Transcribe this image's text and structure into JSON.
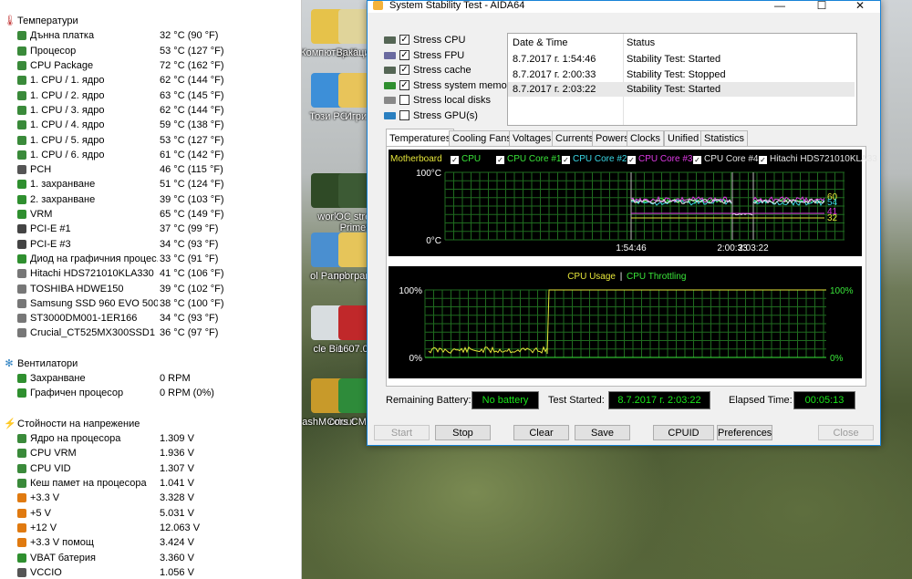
{
  "desktop": {
    "icons": [
      {
        "label": "Компютър К",
        "color": "#e6c24a"
      },
      {
        "label": "Вакация",
        "color": "#e0d49a"
      },
      {
        "label": "Този PC",
        "color": "#3d8fd8"
      },
      {
        "label": "Игри",
        "color": "#e8c45a"
      },
      {
        "label": "work",
        "color": "#2f4a26"
      },
      {
        "label": "OC stres Prime9",
        "color": "#3c5a34"
      },
      {
        "label": "ol Panel",
        "color": "#4a8fd0"
      },
      {
        "label": "програми",
        "color": "#e6c55a"
      },
      {
        "label": "cle Bin",
        "color": "#d8dde0"
      },
      {
        "label": "1607.04",
        "color": "#c0282a"
      },
      {
        "label": "ashM ortcut",
        "color": "#c89a2a"
      },
      {
        "label": "Cors CMK32",
        "color": "#2e8b3a"
      }
    ]
  },
  "sensors": {
    "groups": [
      {
        "title": "Температури",
        "icon": "thermometer-icon",
        "icon_color": "#c03030",
        "rows": [
          {
            "name": "Дънна платка",
            "value": "32 °C  (90 °F)",
            "icon": "motherboard-icon",
            "color": "#3a8a3a"
          },
          {
            "name": "Процесор",
            "value": "53 °C  (127 °F)",
            "icon": "cpu-icon",
            "color": "#3a8a3a"
          },
          {
            "name": "CPU Package",
            "value": "72 °C  (162 °F)",
            "icon": "cpu-icon",
            "color": "#3a8a3a"
          },
          {
            "name": "1. CPU / 1. ядро",
            "value": "62 °C  (144 °F)",
            "icon": "cpu-icon",
            "color": "#3a8a3a"
          },
          {
            "name": "1. CPU / 2. ядро",
            "value": "63 °C  (145 °F)",
            "icon": "cpu-icon",
            "color": "#3a8a3a"
          },
          {
            "name": "1. CPU / 3. ядро",
            "value": "62 °C  (144 °F)",
            "icon": "cpu-icon",
            "color": "#3a8a3a"
          },
          {
            "name": "1. CPU / 4. ядро",
            "value": "59 °C  (138 °F)",
            "icon": "cpu-icon",
            "color": "#3a8a3a"
          },
          {
            "name": "1. CPU / 5. ядро",
            "value": "53 °C  (127 °F)",
            "icon": "cpu-icon",
            "color": "#3a8a3a"
          },
          {
            "name": "1. CPU / 6. ядро",
            "value": "61 °C  (142 °F)",
            "icon": "cpu-icon",
            "color": "#3a8a3a"
          },
          {
            "name": "PCH",
            "value": "46 °C  (115 °F)",
            "icon": "chip-icon",
            "color": "#555555"
          },
          {
            "name": "1. захранване",
            "value": "51 °C  (124 °F)",
            "icon": "power-icon",
            "color": "#2f8f2f"
          },
          {
            "name": "2. захранване",
            "value": "39 °C  (103 °F)",
            "icon": "power-icon",
            "color": "#2f8f2f"
          },
          {
            "name": "VRM",
            "value": "65 °C  (149 °F)",
            "icon": "power-icon",
            "color": "#2f8f2f"
          },
          {
            "name": "PCI-E #1",
            "value": "37 °C  (99 °F)",
            "icon": "slot-icon",
            "color": "#444444"
          },
          {
            "name": "PCI-E #3",
            "value": "34 °C  (93 °F)",
            "icon": "slot-icon",
            "color": "#444444"
          },
          {
            "name": "Диод на графичния процес...",
            "value": "33 °C  (91 °F)",
            "icon": "gpu-icon",
            "color": "#2f8f2f"
          },
          {
            "name": "Hitachi HDS721010KLA330",
            "value": "41 °C  (106 °F)",
            "icon": "disk-icon",
            "color": "#777777"
          },
          {
            "name": "TOSHIBA HDWE150",
            "value": "39 °C  (102 °F)",
            "icon": "disk-icon",
            "color": "#777777"
          },
          {
            "name": "Samsung SSD 960 EVO 500GB",
            "value": "38 °C  (100 °F)",
            "icon": "disk-icon",
            "color": "#777777"
          },
          {
            "name": "ST3000DM001-1ER166",
            "value": "34 °C  (93 °F)",
            "icon": "disk-icon",
            "color": "#777777"
          },
          {
            "name": "Crucial_CT525MX300SSD1",
            "value": "36 °C  (97 °F)",
            "icon": "disk-icon",
            "color": "#777777"
          }
        ]
      },
      {
        "title": "Вентилатори",
        "icon": "fan-icon",
        "icon_color": "#2a7fc0",
        "rows": [
          {
            "name": "Захранване",
            "value": "0 RPM",
            "icon": "power-icon",
            "color": "#2f8f2f"
          },
          {
            "name": "Графичен процесор",
            "value": "0 RPM  (0%)",
            "icon": "gpu-icon",
            "color": "#2f8f2f"
          }
        ]
      },
      {
        "title": "Стойности на напрежение",
        "icon": "voltage-icon",
        "icon_color": "#e07a10",
        "rows": [
          {
            "name": "Ядро на процесора",
            "value": "1.309 V",
            "icon": "cpu-icon",
            "color": "#3a8a3a"
          },
          {
            "name": "CPU VRM",
            "value": "1.936 V",
            "icon": "cpu-icon",
            "color": "#3a8a3a"
          },
          {
            "name": "CPU VID",
            "value": "1.307 V",
            "icon": "cpu-icon",
            "color": "#3a8a3a"
          },
          {
            "name": "Кеш памет на процесора",
            "value": "1.041 V",
            "icon": "cpu-icon",
            "color": "#3a8a3a"
          },
          {
            "name": "+3.3 V",
            "value": "3.328 V",
            "icon": "voltage-icon",
            "color": "#e07a10"
          },
          {
            "name": "+5 V",
            "value": "5.031 V",
            "icon": "voltage-icon",
            "color": "#e07a10"
          },
          {
            "name": "+12 V",
            "value": "12.063 V",
            "icon": "voltage-icon",
            "color": "#e07a10"
          },
          {
            "name": "+3.3 V помощ",
            "value": "3.424 V",
            "icon": "voltage-icon",
            "color": "#e07a10"
          },
          {
            "name": "VBAT батерия",
            "value": "3.360 V",
            "icon": "battery-icon",
            "color": "#2f8f2f"
          },
          {
            "name": "VCCIO",
            "value": "1.056 V",
            "icon": "chip-icon",
            "color": "#555555"
          }
        ]
      }
    ]
  },
  "aida": {
    "title": "System Stability Test - AIDA64",
    "window_controls": {
      "minimize": "—",
      "maximize": "☐",
      "close": "✕"
    },
    "stress_options": [
      {
        "label": "Stress CPU",
        "checked": true,
        "icon": "cpu-icon",
        "color": "#556655"
      },
      {
        "label": "Stress FPU",
        "checked": true,
        "icon": "fpu-icon",
        "color": "#6a6aa0"
      },
      {
        "label": "Stress cache",
        "checked": true,
        "icon": "cache-icon",
        "color": "#556655"
      },
      {
        "label": "Stress system memory",
        "checked": true,
        "icon": "memory-icon",
        "color": "#2f8f2f"
      },
      {
        "label": "Stress local disks",
        "checked": false,
        "icon": "disk-icon",
        "color": "#888888"
      },
      {
        "label": "Stress GPU(s)",
        "checked": false,
        "icon": "gpu-icon",
        "color": "#2a7fc0"
      }
    ],
    "log": {
      "headers": [
        "Date & Time",
        "Status"
      ],
      "rows": [
        [
          "8.7.2017 г. 1:54:46",
          "Stability Test: Started"
        ],
        [
          "8.7.2017 г. 2:00:33",
          "Stability Test: Stopped"
        ],
        [
          "8.7.2017 г. 2:03:22",
          "Stability Test: Started"
        ]
      ]
    },
    "tabs": [
      "Temperatures",
      "Cooling Fans",
      "Voltages",
      "Currents",
      "Powers",
      "Clocks",
      "Unified",
      "Statistics"
    ],
    "active_tab": "Temperatures",
    "temp_legend": [
      {
        "label": "Motherboard",
        "color": "#e6e63a"
      },
      {
        "label": "CPU",
        "color": "#3ae63a"
      },
      {
        "label": "CPU Core #1",
        "color": "#3ae63a"
      },
      {
        "label": "CPU Core #2",
        "color": "#3ad8e6"
      },
      {
        "label": "CPU Core #3",
        "color": "#e03ae6"
      },
      {
        "label": "CPU Core #4",
        "color": "#e6e6e6"
      },
      {
        "label": "Hitachi HDS721010KLA33",
        "color": "#e6e6e6"
      }
    ],
    "temp_axis": {
      "top": "100°C",
      "bottom": "0°C"
    },
    "temp_times": [
      "1:54:46",
      "2:00:33",
      "2:03:22"
    ],
    "temp_end_labels": [
      {
        "text": "60",
        "color": "#e6e63a"
      },
      {
        "text": "54",
        "color": "#3ad8e6"
      },
      {
        "text": "41",
        "color": "#e03ae6"
      },
      {
        "text": "32",
        "color": "#e6e63a"
      }
    ],
    "usage_title": {
      "left": "CPU Usage",
      "sep": "|",
      "right": "CPU Throttling"
    },
    "usage_axis": {
      "left_top": "100%",
      "left_bottom": "0%",
      "right_top": "100%",
      "right_bottom": "0%"
    },
    "status": {
      "battery_label": "Remaining Battery:",
      "battery_value": "No battery",
      "started_label": "Test Started:",
      "started_value": "8.7.2017 г. 2:03:22",
      "elapsed_label": "Elapsed Time:",
      "elapsed_value": "00:05:13"
    },
    "buttons": {
      "start": "Start",
      "stop": "Stop",
      "clear": "Clear",
      "save": "Save",
      "cpuid": "CPUID",
      "preferences": "Preferences",
      "close": "Close"
    }
  },
  "colors": {
    "accent_border": "#1883d7",
    "graph_grid": "#1f6b1f",
    "status_green": "#19e619"
  }
}
